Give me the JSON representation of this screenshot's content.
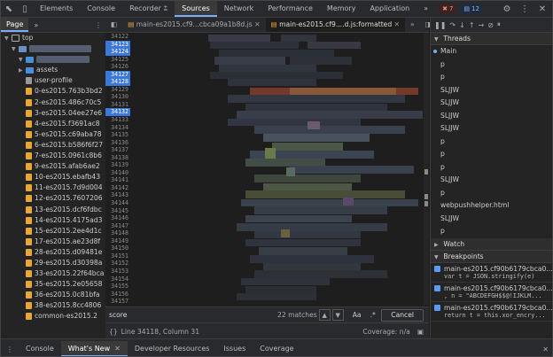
{
  "topbar": {
    "tabs": [
      {
        "label": "Elements",
        "active": false
      },
      {
        "label": "Console",
        "active": false
      },
      {
        "label": "Recorder ⩲",
        "active": false
      },
      {
        "label": "Sources",
        "active": true
      },
      {
        "label": "Network",
        "active": false
      },
      {
        "label": "Performance",
        "active": false
      },
      {
        "label": "Memory",
        "active": false
      },
      {
        "label": "Application",
        "active": false
      }
    ],
    "more": "»",
    "errors_count": "7",
    "messages_count": "12"
  },
  "navigator": {
    "tab_label": "Page",
    "more": "»",
    "items": [
      {
        "label": "top",
        "indent": 0,
        "icon": "frame",
        "caret": "▼"
      },
      {
        "label": "",
        "indent": 1,
        "icon": "cloud",
        "caret": "▼",
        "blurred": true
      },
      {
        "label": "",
        "indent": 2,
        "icon": "folder",
        "caret": "▼",
        "blurred": true
      },
      {
        "label": "assets",
        "indent": 2,
        "icon": "folder",
        "caret": "▶"
      },
      {
        "label": "user-profile",
        "indent": 2,
        "icon": "file-white",
        "caret": ""
      },
      {
        "label": "0-es2015.763b3bd2",
        "indent": 2,
        "icon": "file",
        "caret": ""
      },
      {
        "label": "2-es2015.486c70c5",
        "indent": 2,
        "icon": "file",
        "caret": ""
      },
      {
        "label": "3-es2015.04ee27e6",
        "indent": 2,
        "icon": "file",
        "caret": ""
      },
      {
        "label": "4-es2015.f3691ac8",
        "indent": 2,
        "icon": "file",
        "caret": ""
      },
      {
        "label": "5-es2015.c69aba78",
        "indent": 2,
        "icon": "file",
        "caret": ""
      },
      {
        "label": "6-es2015.b586f6f27",
        "indent": 2,
        "icon": "file",
        "caret": ""
      },
      {
        "label": "7-es2015.0961c8b6",
        "indent": 2,
        "icon": "file",
        "caret": ""
      },
      {
        "label": "9-es2015.afab6ae2",
        "indent": 2,
        "icon": "file",
        "caret": ""
      },
      {
        "label": "10-es2015.ebafb43",
        "indent": 2,
        "icon": "file",
        "caret": ""
      },
      {
        "label": "11-es2015.7d9d004",
        "indent": 2,
        "icon": "file",
        "caret": ""
      },
      {
        "label": "12-es2015.7607206",
        "indent": 2,
        "icon": "file",
        "caret": ""
      },
      {
        "label": "13-es2015.dcf6fdbc",
        "indent": 2,
        "icon": "file",
        "caret": ""
      },
      {
        "label": "14-es2015.4175ad3",
        "indent": 2,
        "icon": "file",
        "caret": ""
      },
      {
        "label": "15-es2015.2ee4d1c",
        "indent": 2,
        "icon": "file",
        "caret": ""
      },
      {
        "label": "17-es2015.ae23d8f",
        "indent": 2,
        "icon": "file",
        "caret": ""
      },
      {
        "label": "28-es2015.d09481e",
        "indent": 2,
        "icon": "file",
        "caret": ""
      },
      {
        "label": "29-es2015.d30398a",
        "indent": 2,
        "icon": "file",
        "caret": ""
      },
      {
        "label": "33-es2015.22f64bca",
        "indent": 2,
        "icon": "file",
        "caret": ""
      },
      {
        "label": "35-es2015.2e05658",
        "indent": 2,
        "icon": "file",
        "caret": ""
      },
      {
        "label": "36-es2015.0c81bfa",
        "indent": 2,
        "icon": "file",
        "caret": ""
      },
      {
        "label": "38-es2015.8cc4806",
        "indent": 2,
        "icon": "file",
        "caret": ""
      },
      {
        "label": "common-es2015.2",
        "indent": 2,
        "icon": "file",
        "caret": ""
      }
    ]
  },
  "editor": {
    "tabs": [
      {
        "label": "main-es2015.cf9...cbca09a1b8d.js",
        "active": false
      },
      {
        "label": "main-es2015.cf9....d.js:formatted",
        "active": true
      }
    ],
    "more": "»",
    "lines": [
      {
        "n": "34122",
        "bp": false
      },
      {
        "n": "34123",
        "bp": true
      },
      {
        "n": "34124",
        "bp": true
      },
      {
        "n": "34125",
        "bp": false
      },
      {
        "n": "34126",
        "bp": false
      },
      {
        "n": "34127",
        "bp": true
      },
      {
        "n": "34128",
        "bp": true
      },
      {
        "n": "34129",
        "bp": false
      },
      {
        "n": "34130",
        "bp": false
      },
      {
        "n": "34131",
        "bp": false
      },
      {
        "n": "34132",
        "bp": true
      },
      {
        "n": "34133",
        "bp": false
      },
      {
        "n": "34134",
        "bp": false
      },
      {
        "n": "34135",
        "bp": false
      },
      {
        "n": "34136",
        "bp": false
      },
      {
        "n": "34137",
        "bp": false
      },
      {
        "n": "34138",
        "bp": false
      },
      {
        "n": "34139",
        "bp": false
      },
      {
        "n": "34140",
        "bp": false
      },
      {
        "n": "34141",
        "bp": false
      },
      {
        "n": "34142",
        "bp": false
      },
      {
        "n": "34143",
        "bp": false
      },
      {
        "n": "34144",
        "bp": false
      },
      {
        "n": "34145",
        "bp": false
      },
      {
        "n": "34146",
        "bp": false
      },
      {
        "n": "34147",
        "bp": false
      },
      {
        "n": "34148",
        "bp": false
      },
      {
        "n": "34149",
        "bp": false
      },
      {
        "n": "34150",
        "bp": false
      },
      {
        "n": "34151",
        "bp": false
      },
      {
        "n": "34152",
        "bp": false
      },
      {
        "n": "34153",
        "bp": false
      },
      {
        "n": "34154",
        "bp": false
      },
      {
        "n": "34155",
        "bp": false
      },
      {
        "n": "34156",
        "bp": false
      },
      {
        "n": "34157",
        "bp": false
      }
    ]
  },
  "search": {
    "query": "score",
    "matches": "22 matches",
    "up": "▲",
    "down": "▼",
    "match_case": "Aa",
    "regex": ".*",
    "cancel": "Cancel"
  },
  "status": {
    "position": "Line 34118, Column 31",
    "coverage": "Coverage: n/a"
  },
  "debugger": {
    "threads_title": "Threads",
    "threads": [
      {
        "label": "Main",
        "selected": true
      },
      {
        "label": "p"
      },
      {
        "label": "p"
      },
      {
        "label": "SLJJW"
      },
      {
        "label": "SLJJW"
      },
      {
        "label": "SLJJW"
      },
      {
        "label": "SLJJW"
      },
      {
        "label": "p"
      },
      {
        "label": "p"
      },
      {
        "label": "p"
      },
      {
        "label": "SLJJW"
      },
      {
        "label": "p"
      },
      {
        "label": "webpushhelper.html"
      },
      {
        "label": "SLJJW"
      },
      {
        "label": "p"
      }
    ],
    "watch_title": "Watch",
    "breakpoints_title": "Breakpoints",
    "breakpoints": [
      {
        "file": "main-es2015.cf90b6179cbca0...",
        "code": "var t = JSON.stringify(e)"
      },
      {
        "file": "main-es2015.cf90b6179cbca0...",
        "code": ", n = \"ABCDEFGH$$@!IJKLM..."
      },
      {
        "file": "main-es2015.cf90b6179cbca0...",
        "code": "return t = this.xor_encry..."
      }
    ]
  },
  "drawer": {
    "tabs": [
      {
        "label": "Console",
        "active": false
      },
      {
        "label": "What's New",
        "active": true
      },
      {
        "label": "Developer Resources",
        "active": false
      },
      {
        "label": "Issues",
        "active": false
      },
      {
        "label": "Coverage",
        "active": false
      }
    ],
    "close": "✕"
  }
}
